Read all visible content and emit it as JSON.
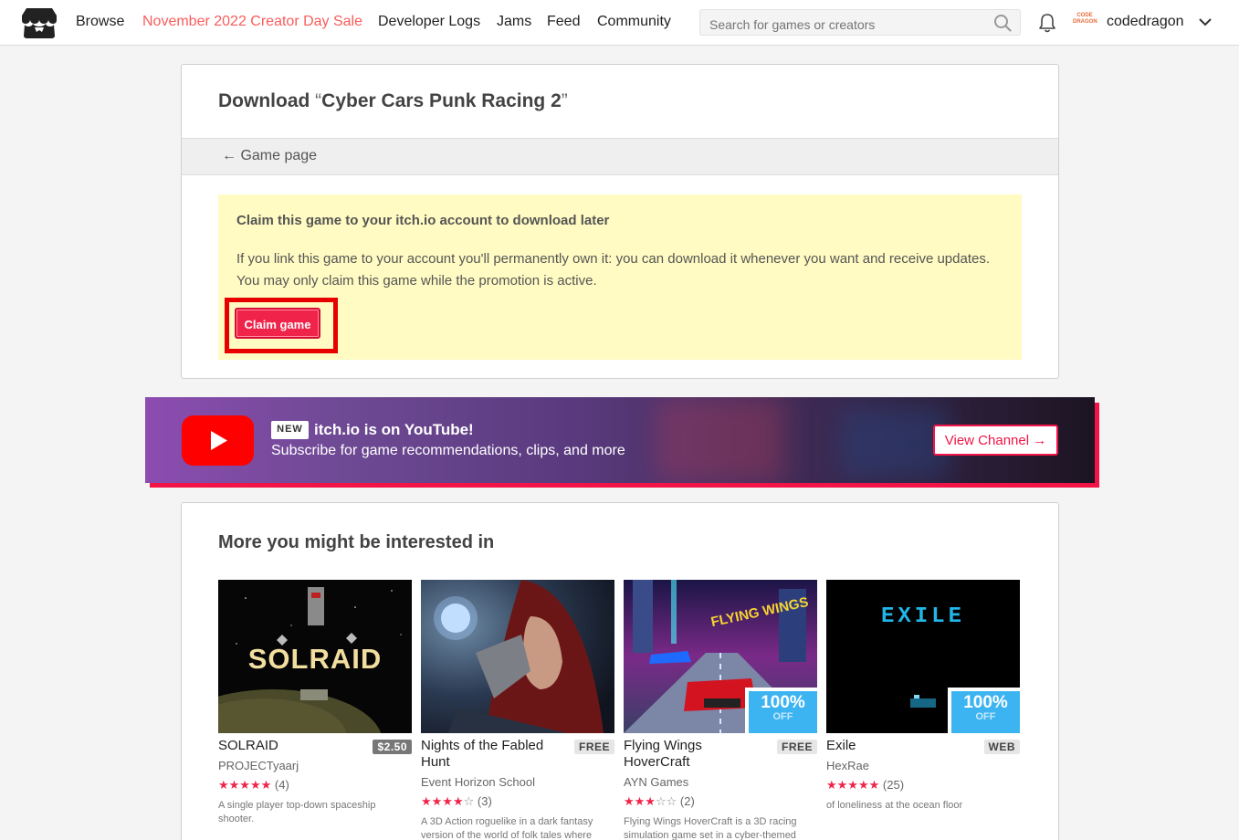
{
  "header": {
    "nav": {
      "browse": "Browse",
      "sale": "November 2022 Creator Day Sale",
      "devlogs": "Developer Logs",
      "jams": "Jams",
      "feed": "Feed",
      "community": "Community"
    },
    "search_placeholder": "Search for games or creators",
    "username": "codedragon",
    "avatar_text": "CODE DRAGON"
  },
  "download": {
    "title_prefix": "Download ",
    "open_quote": "“",
    "game_name": "Cyber Cars Punk Racing 2",
    "close_quote": "”",
    "back_link": "← Game page",
    "claim_title": "Claim this game to your itch.io account to download later",
    "claim_text": "If you link this game to your account you'll permanently own it: you can download it whenever you want and receive updates. You may only claim this game while the promotion is active.",
    "claim_button": "Claim game"
  },
  "youtube_banner": {
    "badge": "NEW",
    "title": "itch.io is on YouTube!",
    "subtitle": "Subscribe for game recommendations, clips, and more",
    "button": "View Channel →"
  },
  "recommendations": {
    "heading": "More you might be interested in",
    "games": [
      {
        "title": "SOLRAID",
        "price": "$2.50",
        "author": "PROJECTyaarj",
        "stars": 5,
        "rating_count": "(4)",
        "description": "A single player top-down spaceship shooter.",
        "thumb_text": "SOLRAID"
      },
      {
        "title": "Nights of the Fabled Hunt",
        "price": "FREE",
        "author": "Event Horizon School",
        "stars": 4,
        "rating_count": "(3)",
        "description": "A 3D Action roguelike in a dark fantasy version of the world of folk tales where"
      },
      {
        "title": "Flying Wings HoverCraft",
        "price": "FREE",
        "author": "AYN Games",
        "stars": 3,
        "rating_count": "(2)",
        "description": "Flying Wings HoverCraft is a 3D racing simulation game set in a cyber-themed",
        "discount_pct": "100%",
        "discount_off": "OFF",
        "thumb_text": "FLYING WINGS"
      },
      {
        "title": "Exile",
        "price": "WEB",
        "author": "HexRae",
        "stars": 5,
        "rating_count": "(25)",
        "description": "of loneliness at the ocean floor",
        "discount_pct": "100%",
        "discount_off": "OFF",
        "thumb_text": "EXILE"
      }
    ]
  },
  "colors": {
    "accent": "#fa5c5c",
    "claim_button": "#f0244a",
    "claim_box": "#fffbc2",
    "highlight_outline": "#e80000",
    "discount": "#3db4f2",
    "youtube_red": "#ff0000"
  }
}
